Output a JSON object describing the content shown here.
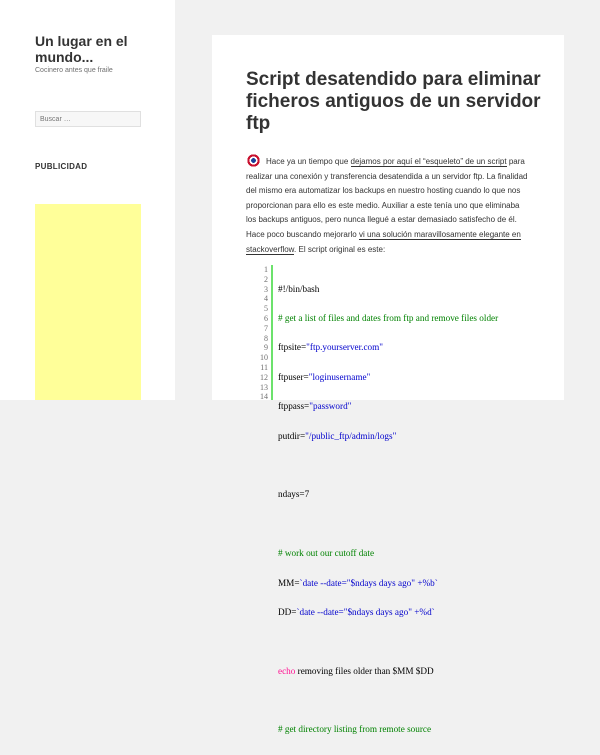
{
  "site": {
    "title": "Un lugar en el mundo...",
    "description": "Cocinero antes que fraile"
  },
  "search": {
    "placeholder": "Buscar …"
  },
  "widget": {
    "title": "PUBLICIDAD"
  },
  "colors": {
    "ad_background": "#ffff99",
    "code_bar": "#6ce26c",
    "comment": "#008200",
    "string": "#0000cc",
    "keyword": "#ff1493"
  },
  "post": {
    "title": "Script desatendido para eliminar ficheros antiguos de un servidor ftp",
    "icon": "captain-america-shield-icon",
    "body": {
      "t1": "Hace ya un tiempo que ",
      "link1": "dejamos por aquí el “esqueleto” de un script",
      "t2": " para realizar una conexión y transferencia desatendida a un servidor ftp. La finalidad del mismo era automatizar los backups en nuestro hosting cuando lo que nos proporcionan para ello es este medio. Auxiliar a este tenía uno que eliminaba los backups antiguos, pero nunca llegué a estar demasiado satisfecho de él. Hace poco buscando mejorarlo ",
      "link2": "vi una solución maravillosamente elegante en stackoverflow",
      "t3": ". El script original es este:"
    }
  },
  "code": {
    "line_numbers": [
      "1",
      "2",
      "3",
      "4",
      "5",
      "6",
      "7",
      "8",
      "9",
      "10",
      "11",
      "12",
      "13",
      "14"
    ],
    "l1": "#!/bin/bash",
    "l2": "# get a list of files and dates from ftp and remove files older",
    "l3_a": "ftpsite=",
    "l3_b": "\"ftp.yourserver.com\"",
    "l4_a": "ftpuser=",
    "l4_b": "\"loginusername\"",
    "l5_a": "ftppass=",
    "l5_b": "\"password\"",
    "l6_a": "putdir=",
    "l6_b": "\"/public_ftp/admin/logs\"",
    "l8": "ndays=7",
    "l10": "# work out our cutoff date",
    "l11_a": "MM=",
    "l11_b": "`date --date=\"$ndays days ago\" +%b`",
    "l12_a": "DD=",
    "l12_b": "`date --date=\"$ndays days ago\" +%d`",
    "l14_a": "echo",
    "l14_b": " removing files older than $MM $DD",
    "l16": "# get directory listing from remote source"
  }
}
